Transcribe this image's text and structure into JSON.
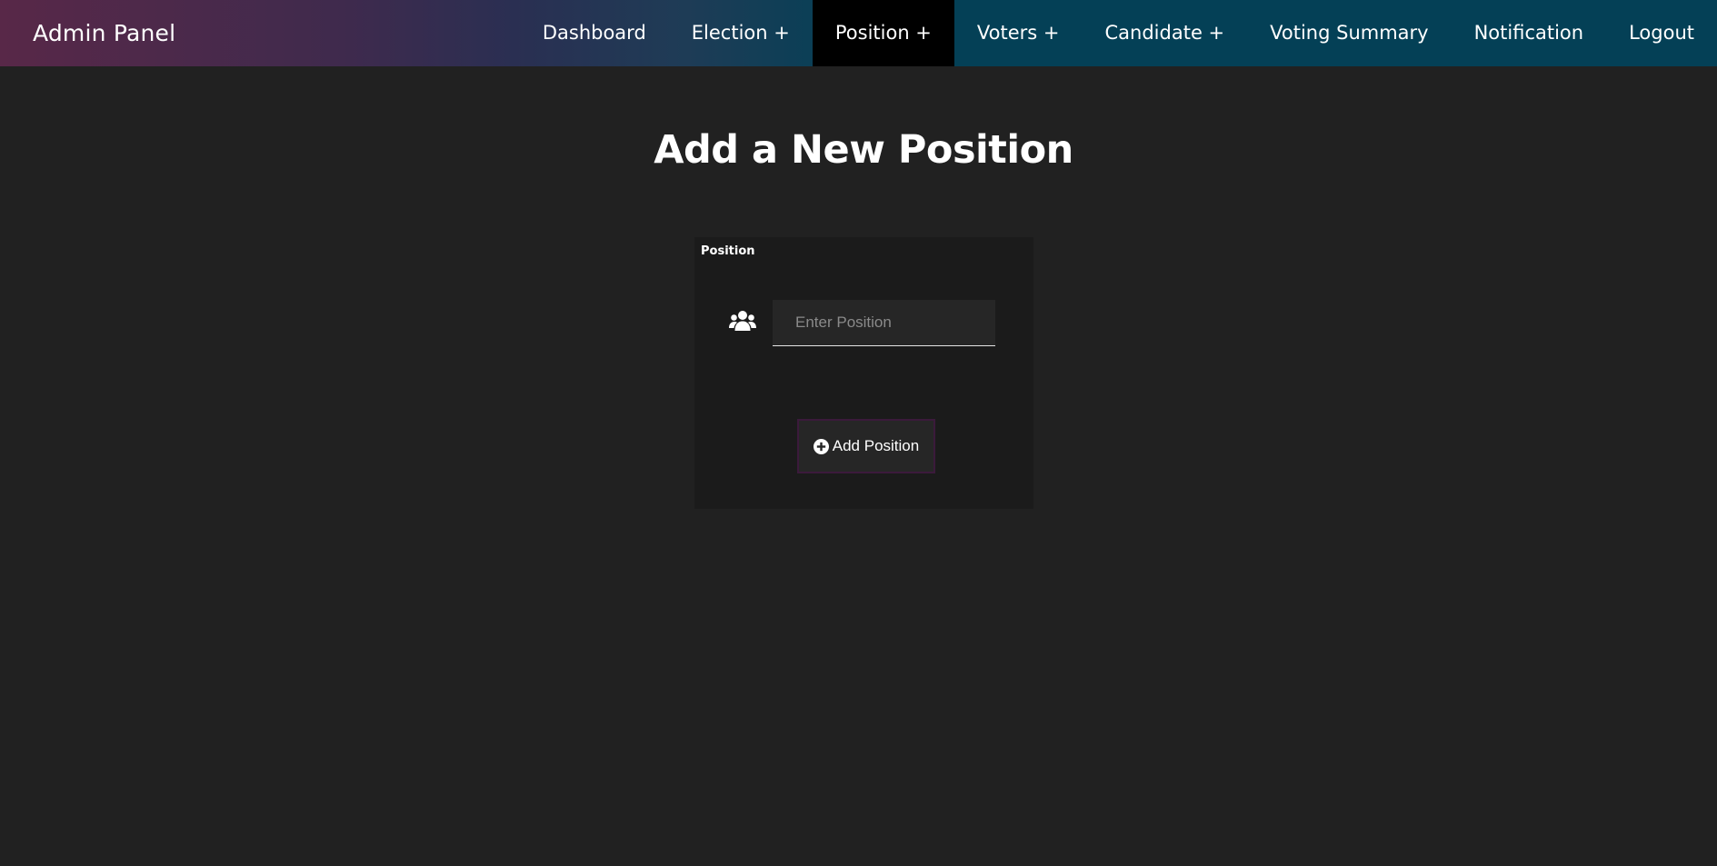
{
  "navbar": {
    "brand": "Admin Panel",
    "items": [
      {
        "label": "Dashboard",
        "active": false
      },
      {
        "label": "Election +",
        "active": false
      },
      {
        "label": "Position +",
        "active": true
      },
      {
        "label": "Voters +",
        "active": false
      },
      {
        "label": "Candidate +",
        "active": false
      },
      {
        "label": "Voting Summary",
        "active": false
      },
      {
        "label": "Notification",
        "active": false
      },
      {
        "label": "Logout",
        "active": false
      }
    ]
  },
  "page": {
    "title": "Add a New Position"
  },
  "form": {
    "card_label": "Position",
    "position_input": {
      "value": "",
      "placeholder": "Enter Position",
      "icon": "users-icon"
    },
    "submit_label": "Add Position",
    "submit_icon": "plus-circle-icon"
  },
  "colors": {
    "background": "#212121",
    "card": "#1b1b1b",
    "nav_solid": "#044056",
    "nav_gradient_start": "#582848",
    "active_tab": "#000000",
    "button_border": "#3b1a3b"
  }
}
